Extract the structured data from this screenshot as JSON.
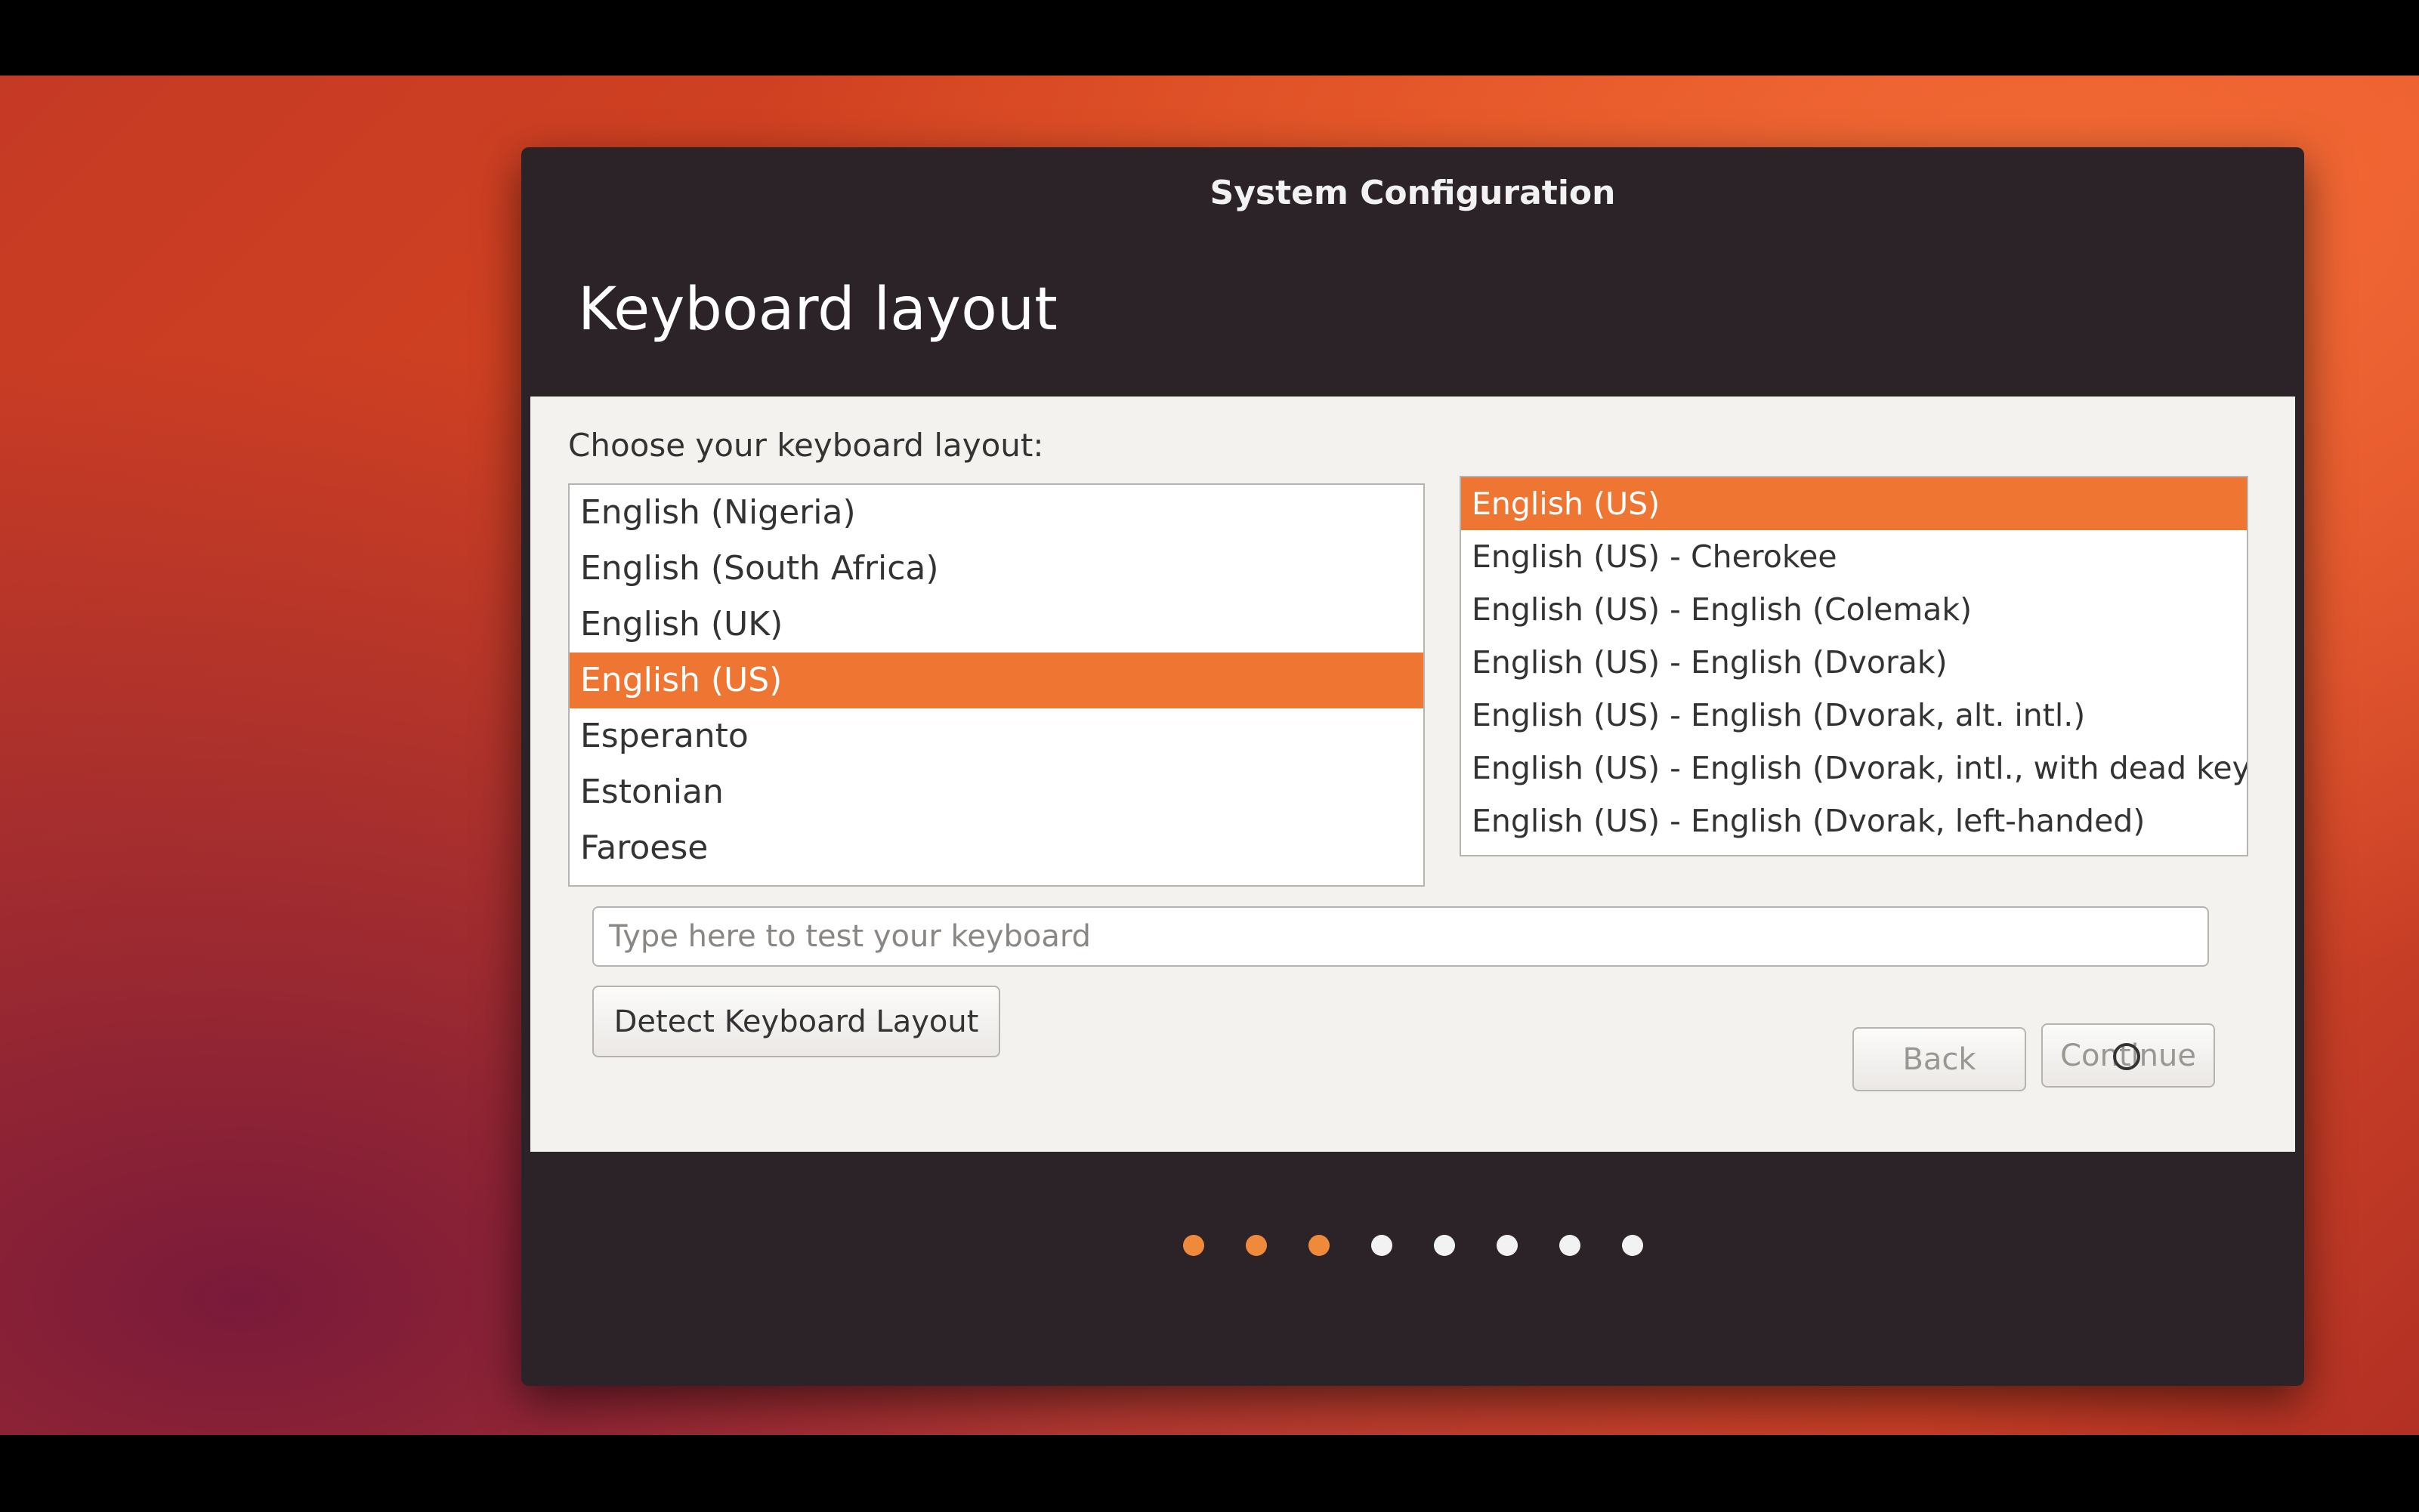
{
  "window": {
    "title": "System Configuration",
    "heading": "Keyboard layout"
  },
  "prompt": "Choose your keyboard layout:",
  "layouts": [
    "English (Nigeria)",
    "English (South Africa)",
    "English (UK)",
    "English (US)",
    "Esperanto",
    "Estonian",
    "Faroese"
  ],
  "selected_layout": "English (US)",
  "variants": [
    "English (US)",
    "English (US) - Cherokee",
    "English (US) - English (Colemak)",
    "English (US) - English (Dvorak)",
    "English (US) - English (Dvorak, alt. intl.)",
    "English (US) - English (Dvorak, intl., with dead keys)",
    "English (US) - English (Dvorak, left-handed)"
  ],
  "selected_variant": "English (US)",
  "test_input": {
    "value": "",
    "placeholder": "Type here to test your keyboard"
  },
  "buttons": {
    "detect": "Detect Keyboard Layout",
    "back": "Back",
    "continue": "Continue"
  },
  "progress": {
    "total_steps": 8,
    "completed_steps": 3
  },
  "colors": {
    "accent": "#ef7632",
    "window_bg": "#2c2328",
    "content_bg": "#f4f2ef"
  }
}
